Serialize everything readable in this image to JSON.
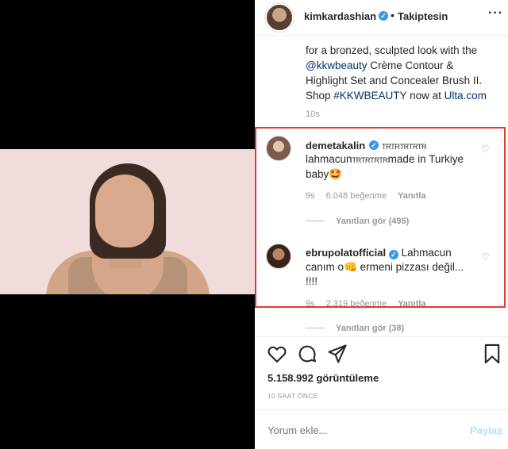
{
  "post": {
    "author": "kimkardashian",
    "follow_status": "Takiptesin",
    "caption_line1": "for a bronzed, sculpted look with the",
    "caption_mention": "@kkwbeauty",
    "caption_line2_rest": " Crème Contour &",
    "caption_line3": "Highlight Set and Concealer Brush II.",
    "caption_shop": "Shop ",
    "caption_hashtag": "#KKWBEAUTY",
    "caption_now": " now at ",
    "caption_site": "Ulta.com",
    "caption_time": "10s"
  },
  "comments": [
    {
      "username": "demetakalin",
      "text_small": "TRTRTRTRTR",
      "text_line1_prefix": "lahmacun",
      "text_line1_small": "TRTRTRTR",
      "text_line1_suffix": "made in Turkiye",
      "text_line2": "baby",
      "emoji": "🤩",
      "time": "9s",
      "likes": "6.048 beğenme",
      "reply_label": "Yanıtla",
      "view_replies": "Yanıtları gör (495)"
    },
    {
      "username": "ebrupolatofficial",
      "text_line1": "Lahmacun",
      "text_line2": "canım o👊 ermeni pizzası değil...",
      "text_line3": "!!!!",
      "time": "9s",
      "likes": "2.319 beğenme",
      "reply_label": "Yanıtla",
      "view_replies": "Yanıtları gör (38)"
    }
  ],
  "stats": {
    "views": "5.158.992 görüntüleme",
    "posted": "10 SAAT ÖNCE"
  },
  "composer": {
    "placeholder": "Yorum ekle...",
    "post_label": "Paylaş"
  },
  "colors": {
    "highlight_border": "#e03a32",
    "verified": "#3897f0",
    "link": "#003569"
  }
}
